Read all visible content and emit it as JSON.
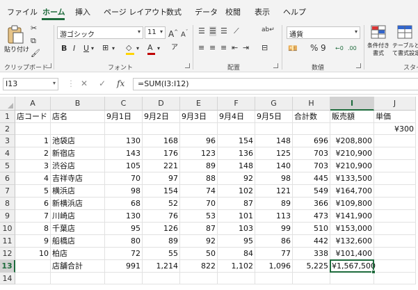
{
  "menu": {
    "tabs": [
      {
        "label": "ファイル",
        "active": false
      },
      {
        "label": "ホーム",
        "active": true
      },
      {
        "label": "挿入",
        "active": false
      },
      {
        "label": "ページ レイアウト",
        "active": false
      },
      {
        "label": "数式",
        "active": false
      },
      {
        "label": "データ",
        "active": false
      },
      {
        "label": "校閲",
        "active": false
      },
      {
        "label": "表示",
        "active": false
      },
      {
        "label": "ヘルプ",
        "active": false
      }
    ]
  },
  "ribbon": {
    "clipboard": {
      "group_label": "クリップボード",
      "paste_label": "貼り付け"
    },
    "font": {
      "group_label": "フォント",
      "font_name": "游ゴシック",
      "font_size": "11"
    },
    "alignment": {
      "group_label": "配置"
    },
    "number": {
      "group_label": "数値",
      "format": "通貨"
    },
    "styles": {
      "group_label": "スタイル",
      "conditional_label": "条件付き書式",
      "table_label": "テーブルとして書式設定"
    }
  },
  "formula_bar": {
    "name_box": "I13",
    "formula": "=SUM(I3:I12)"
  },
  "sheet": {
    "columns": [
      "A",
      "B",
      "C",
      "D",
      "E",
      "F",
      "G",
      "H",
      "I",
      "J"
    ],
    "selected_column": "I",
    "selected_row": 13,
    "rows": [
      {
        "n": "1",
        "cells": [
          "店コード",
          "店名",
          "9月1日",
          "9月2日",
          "9月3日",
          "9月4日",
          "9月5日",
          "合計数",
          "販売額",
          "単価"
        ]
      },
      {
        "n": "2",
        "cells": [
          "",
          "",
          "",
          "",
          "",
          "",
          "",
          "",
          "",
          "¥300"
        ]
      },
      {
        "n": "3",
        "cells": [
          "1",
          "池袋店",
          "130",
          "168",
          "96",
          "154",
          "148",
          "696",
          "¥208,800",
          ""
        ]
      },
      {
        "n": "4",
        "cells": [
          "2",
          "新宿店",
          "143",
          "176",
          "123",
          "136",
          "125",
          "703",
          "¥210,900",
          ""
        ]
      },
      {
        "n": "5",
        "cells": [
          "3",
          "渋谷店",
          "105",
          "221",
          "89",
          "148",
          "140",
          "703",
          "¥210,900",
          ""
        ]
      },
      {
        "n": "6",
        "cells": [
          "4",
          "吉祥寺店",
          "70",
          "97",
          "88",
          "92",
          "98",
          "445",
          "¥133,500",
          ""
        ]
      },
      {
        "n": "7",
        "cells": [
          "5",
          "横浜店",
          "98",
          "154",
          "74",
          "102",
          "121",
          "549",
          "¥164,700",
          ""
        ]
      },
      {
        "n": "8",
        "cells": [
          "6",
          "新横浜店",
          "68",
          "52",
          "70",
          "87",
          "89",
          "366",
          "¥109,800",
          ""
        ]
      },
      {
        "n": "9",
        "cells": [
          "7",
          "川崎店",
          "130",
          "76",
          "53",
          "101",
          "113",
          "473",
          "¥141,900",
          ""
        ]
      },
      {
        "n": "10",
        "cells": [
          "8",
          "千葉店",
          "95",
          "126",
          "87",
          "103",
          "99",
          "510",
          "¥153,000",
          ""
        ]
      },
      {
        "n": "11",
        "cells": [
          "9",
          "船橋店",
          "80",
          "89",
          "92",
          "95",
          "86",
          "442",
          "¥132,600",
          ""
        ]
      },
      {
        "n": "12",
        "cells": [
          "10",
          "柏店",
          "72",
          "55",
          "50",
          "84",
          "77",
          "338",
          "¥101,400",
          ""
        ]
      },
      {
        "n": "13",
        "cells": [
          "",
          "店舗合計",
          "991",
          "1,214",
          "822",
          "1,102",
          "1,096",
          "5,225",
          "¥1,567,500",
          ""
        ]
      },
      {
        "n": "14",
        "cells": [
          "",
          "",
          "",
          "",
          "",
          "",
          "",
          "",
          "",
          ""
        ]
      }
    ]
  },
  "colors": {
    "accent": "#1e6b3c",
    "red": "#c00000",
    "highlight": "#ffd400"
  }
}
